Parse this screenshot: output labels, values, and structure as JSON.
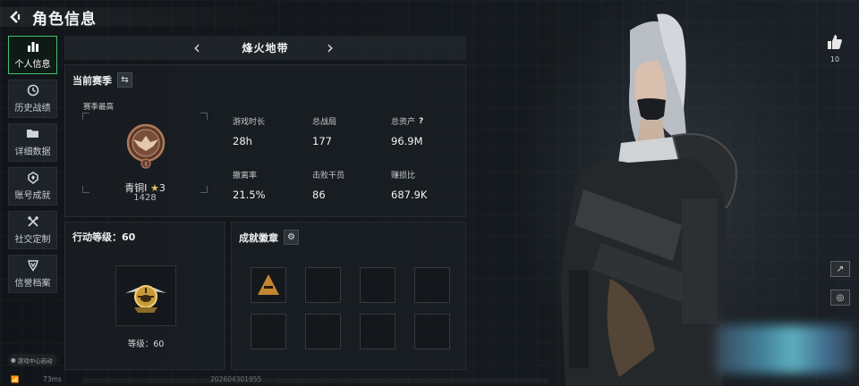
{
  "header": {
    "title": "角色信息"
  },
  "sidebar": {
    "items": [
      {
        "label": "个人信息",
        "icon": "bar-chart-icon",
        "active": true
      },
      {
        "label": "历史战绩",
        "icon": "clock-icon"
      },
      {
        "label": "详细数据",
        "icon": "folder-icon"
      },
      {
        "label": "账号成就",
        "icon": "medal-icon"
      },
      {
        "label": "社交定制",
        "icon": "tools-icon"
      },
      {
        "label": "信誉档案",
        "icon": "shield-icon"
      }
    ],
    "game_center": "游戏中心启动"
  },
  "tabbar": {
    "title": "烽火地带"
  },
  "season": {
    "title": "当前赛季",
    "best_label": "赛季最高",
    "rank_name": "青铜I",
    "rank_stars": "3",
    "rank_score": "1428",
    "stats": [
      {
        "label": "游戏时长",
        "value": "28h"
      },
      {
        "label": "总战局",
        "value": "177"
      },
      {
        "label": "总资产",
        "value": "96.9M",
        "help": "?"
      },
      {
        "label": "撤离率",
        "value": "21.5%"
      },
      {
        "label": "击败干员",
        "value": "86"
      },
      {
        "label": "赚损比",
        "value": "687.9K"
      }
    ]
  },
  "level": {
    "title": "行动等级：60",
    "text": "等级：60"
  },
  "badges": {
    "title": "成就徽章"
  },
  "likes": {
    "count": "10"
  },
  "footer": {
    "ping": "73ms",
    "uid": "202604301955"
  },
  "colors": {
    "accent_green": "#3fbf72",
    "rank_bronze": "#b07a5a"
  }
}
